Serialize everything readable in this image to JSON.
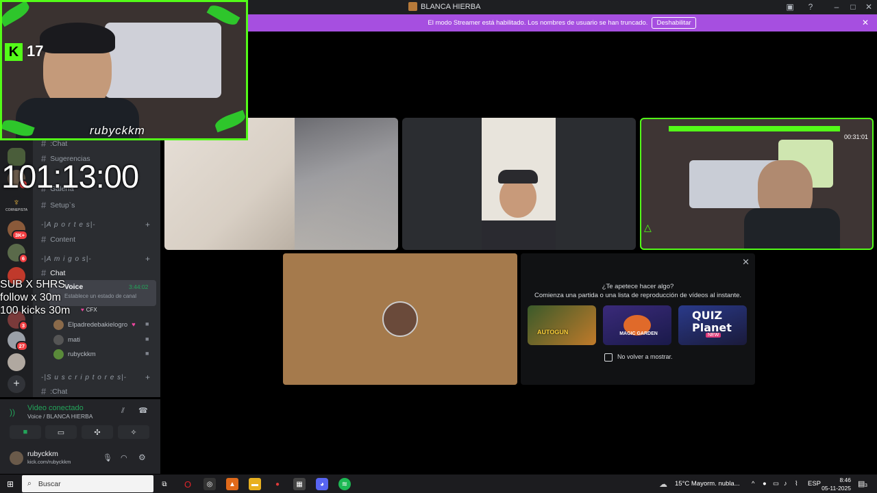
{
  "window": {
    "title": "BLANCA HIERBA"
  },
  "banner": {
    "text": "El modo Streamer está habilitado. Los nombres de usuario se han truncado.",
    "button": "Deshabilitar"
  },
  "stream_overlay": {
    "kick_count": "17",
    "streamer_tag": "rubyckkm",
    "timer": "101:13:00",
    "lines": [
      "SUB X 5HRS",
      "follow x 30m",
      "100 kicks 30m"
    ]
  },
  "rail": {
    "badges": [
      "6",
      "3K+",
      "6",
      "3",
      "27"
    ],
    "server_label": "CORNEPISTA"
  },
  "channels": {
    "top_items": [
      ":Chat",
      "Sugerencias",
      "Galería",
      "Setup`s"
    ],
    "categories": [
      {
        "name": "-|A p o r t e s|-"
      },
      {
        "name": "-|A m i g o s|-"
      },
      {
        "name": "-|S u s c r i p t o r e s|-"
      }
    ],
    "content_channel": "Content",
    "amigos_chat": "Chat",
    "voice_channel": "Voice",
    "voice_time": "3:44:02",
    "voice_status": "Establece un estado de canal",
    "cfx_tag": "CFX",
    "voice_users": [
      "Elpadredebakielogro",
      "mati",
      "rubyckkm"
    ],
    "subs_chat": ":Chat"
  },
  "voice_panel": {
    "status": "Video conectado",
    "location": "Voice / BLANCA HIERBA"
  },
  "user": {
    "name": "rubyckkm",
    "status": "kick.com/rubyckkm"
  },
  "activity": {
    "question": "¿Te apetece hacer algo?",
    "subtitle": "Comienza una partida o una lista de reproducción de vídeos al instante.",
    "games": [
      "AUTOGUN",
      "MAGIC GARDEN",
      "QUIZ Planet"
    ],
    "quiz_new": "NEW",
    "checkbox_label": "No volver a mostrar."
  },
  "tile3_overlay": {
    "time": "00:31:01"
  },
  "taskbar": {
    "search_placeholder": "Buscar",
    "weather": "15°C  Mayorm. nubla...",
    "lang": "ESP",
    "time": "8:46",
    "date": "05-11-2025",
    "notif_count": "3"
  },
  "colors": {
    "kick_green": "#53fc18",
    "banner_purple": "#a64fe0",
    "discord_bg": "#2b2d31",
    "voice_green": "#23a55a"
  }
}
